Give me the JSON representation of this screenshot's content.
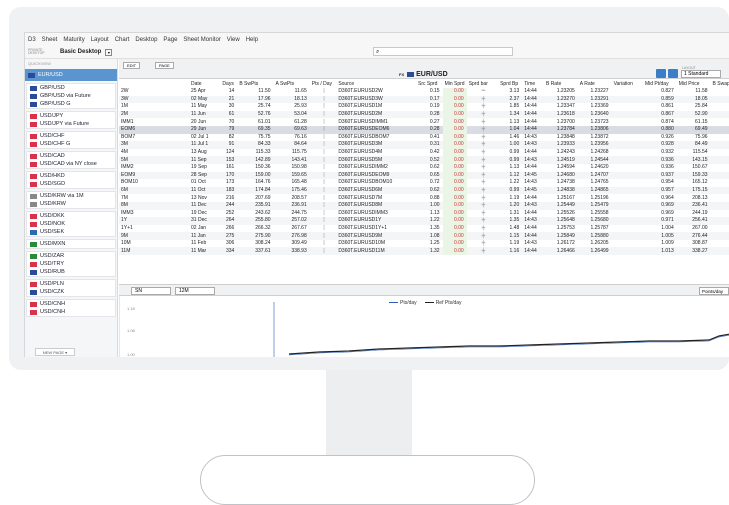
{
  "menu": [
    "D3",
    "Sheet",
    "Maturity",
    "Layout",
    "Chart",
    "Desktop",
    "Page",
    "Sheet Monitor",
    "View",
    "Help"
  ],
  "titlebar": {
    "private_label": "PRIVATE DESKTOP",
    "desk_title": "Basic Desktop",
    "dropdown_glyph": "▾"
  },
  "sidebar": {
    "quickview": "QUICKVIEW",
    "items": [
      {
        "label": "EUR/USD",
        "active": true,
        "flag": "#2a4a9a"
      },
      {
        "group": true,
        "items": [
          {
            "label": "GBP/USD",
            "flag": "#2a4a9a"
          },
          {
            "label": "GBP/USD via Future",
            "flag": "#2a4a9a"
          },
          {
            "label": "GBP/USD G",
            "flag": "#2a4a9a"
          }
        ]
      },
      {
        "group": true,
        "items": [
          {
            "label": "USD/JPY",
            "flag": "#d8334a"
          },
          {
            "label": "USD/JPY via Future",
            "flag": "#d8334a"
          }
        ]
      },
      {
        "group": true,
        "items": [
          {
            "label": "USD/CHF",
            "flag": "#d8334a"
          },
          {
            "label": "USD/CHF G",
            "flag": "#d8334a"
          }
        ]
      },
      {
        "group": true,
        "items": [
          {
            "label": "USD/CAD",
            "flag": "#d8334a"
          },
          {
            "label": "USD/CAD via NY close",
            "flag": "#d8334a"
          }
        ]
      },
      {
        "group": true,
        "items": [
          {
            "label": "USD/HKD",
            "flag": "#d8334a"
          },
          {
            "label": "USD/SGD",
            "flag": "#d8334a"
          }
        ]
      },
      {
        "group": true,
        "items": [
          {
            "label": "USD/KRW via 1M",
            "flag": "#888"
          },
          {
            "label": "USD/KRW",
            "flag": "#888"
          }
        ]
      },
      {
        "group": true,
        "items": [
          {
            "label": "USD/DKK",
            "flag": "#d8334a"
          },
          {
            "label": "USD/NOK",
            "flag": "#d8334a"
          },
          {
            "label": "USD/SEK",
            "flag": "#2a6ab0"
          }
        ]
      },
      {
        "group": true,
        "items": [
          {
            "label": "USD/MXN",
            "flag": "#2a8a3a"
          }
        ]
      },
      {
        "group": true,
        "items": [
          {
            "label": "USD/ZAR",
            "flag": "#2a8a3a"
          },
          {
            "label": "USD/TRY",
            "flag": "#d8334a"
          },
          {
            "label": "USD/RUB",
            "flag": "#2a4a9a"
          }
        ]
      },
      {
        "group": true,
        "items": [
          {
            "label": "USD/PLN",
            "flag": "#d8334a"
          },
          {
            "label": "USD/CZK",
            "flag": "#2a4a9a"
          }
        ]
      },
      {
        "group": true,
        "items": [
          {
            "label": "USD/CNH",
            "flag": "#d8334a"
          },
          {
            "label": "USD/CNH",
            "flag": "#d8334a"
          }
        ]
      }
    ],
    "new_page": "NEW PAGE ▾"
  },
  "toolbar": {
    "edit": "EDIT",
    "page": "PAGE",
    "pair_prefix": "FX",
    "pair": "EUR/USD",
    "layout_label": "LAYOUT",
    "layout_value": "1 Standard"
  },
  "table": {
    "columns": [
      "",
      "Date",
      "Days",
      "B SwPts",
      "A SwPts",
      "Pts / Day",
      "Source",
      "Src Sprd",
      "Min Sprd",
      "Sprd bar",
      "Sprd Bp",
      "Time",
      "B Rate",
      "A Rate",
      "Variation",
      "Mid Pt/day",
      "Mid Price",
      "B Swap %",
      "A S"
    ],
    "rows": [
      [
        "2W",
        "25 Apr",
        "14",
        "11.50",
        "11.65",
        "|",
        "D360T.EURUSD2W",
        "0.15",
        "0.00",
        "═",
        "3.13",
        "14:44",
        "1.23205",
        "1.23227",
        "",
        "0.827",
        "11.58",
        "2.40",
        ""
      ],
      [
        "3W",
        "02 May",
        "21",
        "17.96",
        "18.13",
        "|",
        "D360T.EURUSD3W",
        "0.17",
        "0.00",
        "╪",
        "2.37",
        "14:44",
        "1.23270",
        "1.23291",
        "",
        "0.859",
        "18.05",
        "2.50",
        ""
      ],
      [
        "1M",
        "11 May",
        "30",
        "25.74",
        "25.93",
        "|",
        "D360T.EURUSD1M",
        "0.19",
        "0.00",
        "╪",
        "1.85",
        "14:44",
        "1.23347",
        "1.23369",
        "",
        "0.861",
        "25.84",
        "2.51",
        ""
      ],
      [
        "2M",
        "11 Jun",
        "61",
        "52.76",
        "53.04",
        "|",
        "D360T.EURUSD2M",
        "0.28",
        "0.00",
        "╪",
        "1.34",
        "14:44",
        "1.23618",
        "1.23640",
        "",
        "0.867",
        "52.90",
        "2.53",
        ""
      ],
      [
        "IMM1",
        "20 Jun",
        "70",
        "61.01",
        "61.28",
        "|",
        "D360T.EURUSDIMM1",
        "0.27",
        "0.00",
        "╪",
        "1.13",
        "14:44",
        "1.23700",
        "1.23723",
        "",
        "0.874",
        "61.15",
        "2.55",
        ""
      ],
      [
        "EOM6",
        "29 Jun",
        "79",
        "69.35",
        "69.63",
        "|",
        "D360T.EURUSDEOM6",
        "0.28",
        "0.00",
        "╪",
        "1.04",
        "14:44",
        "1.23784",
        "1.23806",
        "",
        "0.880",
        "69.49",
        "2.57",
        ""
      ],
      [
        "BOM7",
        "02 Jul 1",
        "82",
        "75.75",
        "76.16",
        "|",
        "D360T.EURUSDBOM7",
        "0.41",
        "0.00",
        "╪",
        "1.46",
        "14:43",
        "1.23848",
        "1.23872",
        "",
        "0.926",
        "75.96",
        "2.70",
        ""
      ],
      [
        "3M",
        "11 Jul 1",
        "91",
        "84.33",
        "84.64",
        "|",
        "D360T.EURUSD3M",
        "0.31",
        "0.00",
        "╪",
        "1.00",
        "14:43",
        "1.23933",
        "1.23956",
        "",
        "0.928",
        "84.49",
        "2.71",
        ""
      ],
      [
        "4M",
        "13 Aug",
        "124",
        "115.33",
        "115.75",
        "|",
        "D360T.EURUSD4M",
        "0.42",
        "0.00",
        "╪",
        "0.99",
        "14:44",
        "1.24243",
        "1.24268",
        "",
        "0.932",
        "115.54",
        "2.72",
        ""
      ],
      [
        "5M",
        "11 Sep",
        "153",
        "142.89",
        "143.41",
        "|",
        "D360T.EURUSD5M",
        "0.52",
        "0.00",
        "╪",
        "0.99",
        "14:43",
        "1.24519",
        "1.24544",
        "",
        "0.936",
        "143.15",
        "2.73",
        ""
      ],
      [
        "IMM2",
        "19 Sep",
        "161",
        "150.36",
        "150.98",
        "|",
        "D360T.EURUSDIMM2",
        "0.62",
        "0.00",
        "╪",
        "1.13",
        "14:44",
        "1.24594",
        "1.24620",
        "",
        "0.936",
        "150.67",
        "2.73",
        ""
      ],
      [
        "EOM9",
        "28 Sep",
        "170",
        "159.00",
        "159.65",
        "|",
        "D360T.EURUSDEOM9",
        "0.65",
        "0.00",
        "╪",
        "1.12",
        "14:45",
        "1.24680",
        "1.24707",
        "",
        "0.937",
        "159.33",
        "2.74",
        ""
      ],
      [
        "BOM10",
        "01 Oct",
        "173",
        "164.76",
        "165.48",
        "|",
        "D360T.EURUSDBOM10",
        "0.72",
        "0.00",
        "╪",
        "1.22",
        "14:43",
        "1.24738",
        "1.24765",
        "",
        "0.954",
        "165.12",
        "2.79",
        ""
      ],
      [
        "6M",
        "11 Oct",
        "183",
        "174.84",
        "175.46",
        "|",
        "D360T.EURUSD6M",
        "0.62",
        "0.00",
        "╪",
        "0.99",
        "14:45",
        "1.24838",
        "1.24865",
        "",
        "0.957",
        "175.15",
        "2.79",
        ""
      ],
      [
        "7M",
        "13 Nov",
        "216",
        "207.69",
        "208.57",
        "|",
        "D360T.EURUSD7M",
        "0.88",
        "0.00",
        "╪",
        "1.19",
        "14:44",
        "1.25167",
        "1.25196",
        "",
        "0.964",
        "208.13",
        "2.81",
        ""
      ],
      [
        "8M",
        "11 Dec",
        "244",
        "235.91",
        "236.91",
        "|",
        "D360T.EURUSD8M",
        "1.00",
        "0.00",
        "╪",
        "1.20",
        "14:43",
        "1.25449",
        "1.25479",
        "",
        "0.969",
        "236.41",
        "2.83",
        ""
      ],
      [
        "IMM3",
        "19 Dec",
        "252",
        "243.62",
        "244.75",
        "|",
        "D360T.EURUSDIMM3",
        "1.13",
        "0.00",
        "╪",
        "1.31",
        "14:44",
        "1.25526",
        "1.25558",
        "",
        "0.969",
        "244.19",
        "2.83",
        ""
      ],
      [
        "1Y",
        "31 Dec",
        "264",
        "255.80",
        "257.02",
        "|",
        "D360T.EURUSD1Y",
        "1.22",
        "0.00",
        "╪",
        "1.35",
        "14:43",
        "1.25648",
        "1.25680",
        "",
        "0.971",
        "256.41",
        "2.83",
        ""
      ],
      [
        "1Y+1",
        "02 Jan",
        "266",
        "266.32",
        "267.67",
        "|",
        "D360T.EURUSD1Y+1",
        "1.35",
        "0.00",
        "╪",
        "1.48",
        "14:44",
        "1.25753",
        "1.25787",
        "",
        "1.004",
        "267.00",
        "2.93",
        ""
      ],
      [
        "9M",
        "11 Jan",
        "275",
        "275.90",
        "276.98",
        "|",
        "D360T.EURUSD9M",
        "1.08",
        "0.00",
        "╪",
        "1.15",
        "14:44",
        "1.25849",
        "1.25880",
        "",
        "1.005",
        "276.44",
        "2.93",
        ""
      ],
      [
        "10M",
        "11 Feb",
        "306",
        "308.24",
        "309.49",
        "|",
        "D360T.EURUSD10M",
        "1.25",
        "0.00",
        "╪",
        "1.19",
        "14:43",
        "1.26172",
        "1.26205",
        "",
        "1.009",
        "308.87",
        "2.95",
        ""
      ],
      [
        "11M",
        "11 Mar",
        "334",
        "337.61",
        "338.93",
        "|",
        "D360T.EURUSD11M",
        "1.32",
        "0.00",
        "╪",
        "1.16",
        "14:44",
        "1.26466",
        "1.26499",
        "",
        "1.013",
        "338.27",
        "2.96",
        ""
      ]
    ]
  },
  "chart_bar": {
    "series_sel": "SN",
    "range_sel": "12M",
    "points_btn": "Points/day"
  },
  "chart": {
    "legend": [
      {
        "name": "Pts/day",
        "color": "#2a5fb8"
      },
      {
        "name": "Ref Pts/day",
        "color": "#222222"
      }
    ],
    "yticks": [
      "1.18",
      "1.08",
      "1.00"
    ]
  }
}
